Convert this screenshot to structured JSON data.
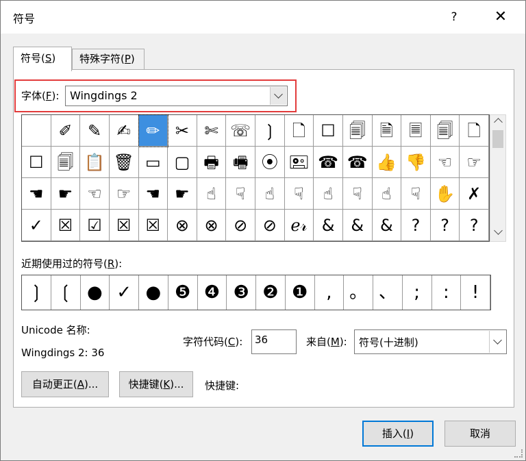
{
  "window": {
    "title": "符号",
    "help": "?",
    "close": "✕"
  },
  "tabs": [
    {
      "pre": "符号(",
      "key": "S",
      "post": ")"
    },
    {
      "pre": "特殊字符(",
      "key": "P",
      "post": ")"
    }
  ],
  "font": {
    "pre": "字体(",
    "key": "F",
    "post": "):",
    "value": "Wingdings 2"
  },
  "grid": {
    "rows": [
      [
        "",
        "✐",
        "✎",
        "✍",
        "✏",
        "✂",
        "✄",
        "☏",
        "❳",
        "🗋",
        "☐",
        "🗐",
        "🗎",
        "🗏",
        "🗐",
        "🗋"
      ],
      [
        "☐",
        "🗐",
        "📋",
        "🗑",
        "▭",
        "▢",
        "🖶",
        "🖷",
        "⦿",
        "🖭",
        "☎",
        "☎",
        "👍",
        "👎",
        "☜",
        "☞"
      ],
      [
        "☚",
        "☛",
        "☜",
        "☞",
        "☚",
        "☛",
        "☝",
        "☟",
        "☝",
        "☟",
        "☝",
        "☟",
        "☝",
        "☟",
        "✋",
        "✗"
      ],
      [
        "✓",
        "☒",
        "☑",
        "☒",
        "☒",
        "⊗",
        "⊗",
        "⊘",
        "⊘",
        "ℯ𝓇",
        "&",
        "&",
        "&",
        "?",
        "?",
        "?"
      ]
    ],
    "selected": [
      0,
      4
    ]
  },
  "recent": {
    "label_pre": "近期使用过的符号(",
    "label_key": "R",
    "label_post": "):",
    "items": [
      "❳",
      "❲",
      "●",
      "✓",
      "●",
      "❺",
      "❹",
      "❸",
      "❷",
      "❶",
      ",",
      "。",
      "、",
      ";",
      ":",
      "!"
    ]
  },
  "unicode": {
    "label": "Unicode 名称:",
    "value": "Wingdings 2: 36"
  },
  "char_code": {
    "pre": "字符代码(",
    "key": "C",
    "post": "):",
    "value": "36"
  },
  "from": {
    "pre": "来自(",
    "key": "M",
    "post": "):",
    "value": "符号(十进制)"
  },
  "buttons": {
    "autocorrect": {
      "pre": "自动更正(",
      "key": "A",
      "post": ")..."
    },
    "shortcut": {
      "pre": "快捷键(",
      "key": "K",
      "post": ")..."
    },
    "shortcut_label": "快捷键:",
    "insert": {
      "pre": "插入(",
      "key": "I",
      "post": ")"
    },
    "cancel": "取消"
  }
}
